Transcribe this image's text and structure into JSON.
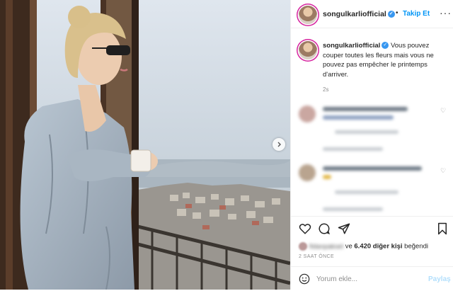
{
  "post": {
    "username": "songulkarliofficial",
    "verified": true,
    "separator": "•",
    "follow_label": "Takip Et",
    "more_label": "···",
    "caption_username": "songulkarliofficial",
    "caption_text": "Vous pouvez couper toutes les fleurs mais vous ne pouvez pas empêcher le printemps d'arriver.",
    "caption_time": "2s"
  },
  "likes": {
    "blurred_name": "fidanpaksel",
    "text_ve": "ve",
    "count_label": "6.420 diğer kişi",
    "suffix": "beğendi"
  },
  "time_ago": "2 SAAT ÖNCE",
  "composer": {
    "placeholder": "Yorum ekle...",
    "post_label": "Paylaş"
  },
  "icons": {
    "heart": "heart-icon",
    "comment": "comment-icon",
    "share": "share-icon",
    "save": "bookmark-icon",
    "emoji": "smile-icon",
    "next": "chevron-right-icon",
    "verified": "verified-badge-icon"
  },
  "colors": {
    "accent": "#0095f6",
    "verified": "#3897f0",
    "text": "#262626",
    "muted": "#8e8e8e",
    "post_disabled": "#b2dffc"
  }
}
